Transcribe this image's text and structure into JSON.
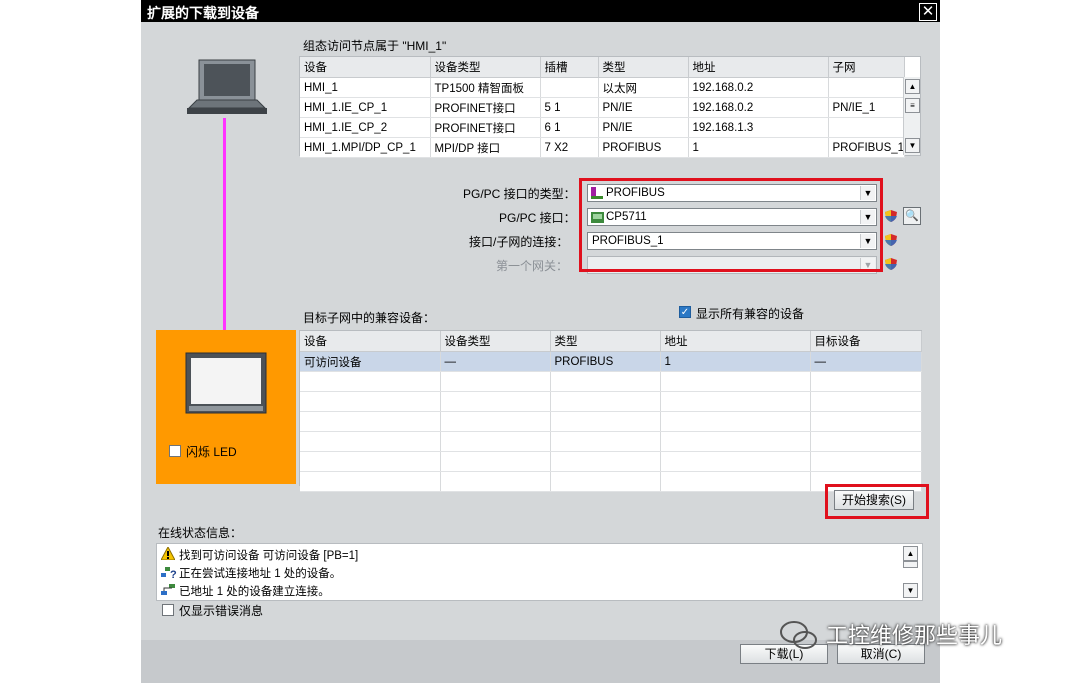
{
  "dialog": {
    "title": "扩展的下载到设备",
    "close_glyph": "✕"
  },
  "config": {
    "heading": "组态访问节点属于 \"HMI_1\"",
    "columns": [
      "设备",
      "设备类型",
      "插槽",
      "类型",
      "地址",
      "子网"
    ],
    "rows": [
      [
        "HMI_1",
        "TP1500 精智面板",
        "",
        "以太网",
        "192.168.0.2",
        ""
      ],
      [
        "HMI_1.IE_CP_1",
        "PROFINET接口",
        "5 1",
        "PN/IE",
        "192.168.0.2",
        "PN/IE_1"
      ],
      [
        "HMI_1.IE_CP_2",
        "PROFINET接口",
        "6 1",
        "PN/IE",
        "192.168.1.3",
        ""
      ],
      [
        "HMI_1.MPI/DP_CP_1",
        "MPI/DP 接口",
        "7 X2",
        "PROFIBUS",
        "1",
        "PROFIBUS_1"
      ]
    ]
  },
  "interface": {
    "type_label": "PG/PC 接口的类型：",
    "type_value": "PROFIBUS",
    "iface_label": "PG/PC 接口：",
    "iface_value": "CP5711",
    "conn_label": "接口/子网的连接：",
    "conn_value": "PROFIBUS_1",
    "gateway_label": "第一个网关：",
    "gateway_value": ""
  },
  "compatible": {
    "heading": "目标子网中的兼容设备：",
    "show_all_label": "显示所有兼容的设备",
    "show_all_checked": true,
    "columns": [
      "设备",
      "设备类型",
      "类型",
      "地址",
      "目标设备"
    ],
    "rows": [
      [
        "可访问设备",
        "—",
        "PROFIBUS",
        "1",
        "—"
      ]
    ]
  },
  "flash_led_label": "闪烁 LED",
  "search_button": "开始搜索(S)",
  "status": {
    "heading": "在线状态信息：",
    "messages": [
      {
        "icon": "warning-icon",
        "text": "找到可访问设备 可访问设备 [PB=1]"
      },
      {
        "icon": "network-query-icon",
        "text": "正在尝试连接地址 1 处的设备。"
      },
      {
        "icon": "network-connected-icon",
        "text": "已地址 1 处的设备建立连接。"
      }
    ],
    "errors_only_label": "仅显示错误消息"
  },
  "buttons": {
    "load": "下载(L)",
    "cancel": "取消(C)"
  },
  "watermark": "工控维修那些事儿",
  "colors": {
    "highlight_red": "#e0101d",
    "target_panel": "#ff9900",
    "link_line": "#ff33ff"
  }
}
